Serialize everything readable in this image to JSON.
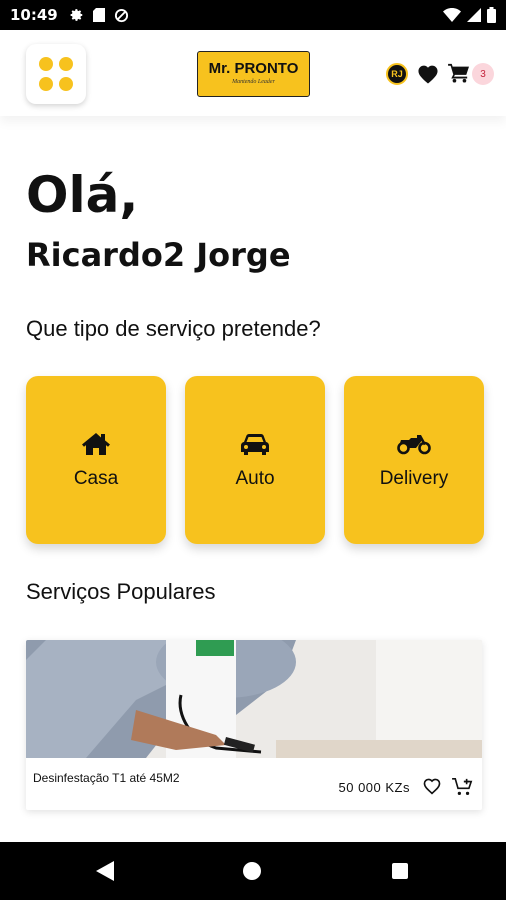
{
  "status_bar": {
    "time": "10:49",
    "icons": [
      "gear-icon",
      "sim-card-icon",
      "data-saver-icon",
      "wifi-icon",
      "signal-icon",
      "battery-icon"
    ]
  },
  "header": {
    "menu_icon": "grid-dots-icon",
    "logo_text": "Mr. PRONTO",
    "logo_tagline": "Mantendo Leader",
    "avatar_initials": "RJ",
    "favorites_icon": "heart-icon",
    "cart_icon": "cart-icon",
    "cart_count": "3"
  },
  "greeting": {
    "hello": "Olá,",
    "user_name": "Ricardo2 Jorge"
  },
  "services": {
    "question": "Que tipo de serviço pretende?",
    "items": [
      {
        "label": "Casa",
        "icon": "home-icon"
      },
      {
        "label": "Auto",
        "icon": "car-icon"
      },
      {
        "label": "Delivery",
        "icon": "motorcycle-icon"
      }
    ]
  },
  "popular": {
    "title": "Serviços Populares",
    "items": [
      {
        "name": "Desinfestação T1 até 45M2",
        "price": "50 000 KZs",
        "image": "disinfection-spraying-photo"
      }
    ]
  },
  "colors": {
    "accent": "#f7c21e",
    "badge_bg": "#fbd6dc",
    "badge_text": "#c4243d"
  },
  "nav": [
    "back-icon",
    "home-circle-icon",
    "recent-apps-icon"
  ]
}
